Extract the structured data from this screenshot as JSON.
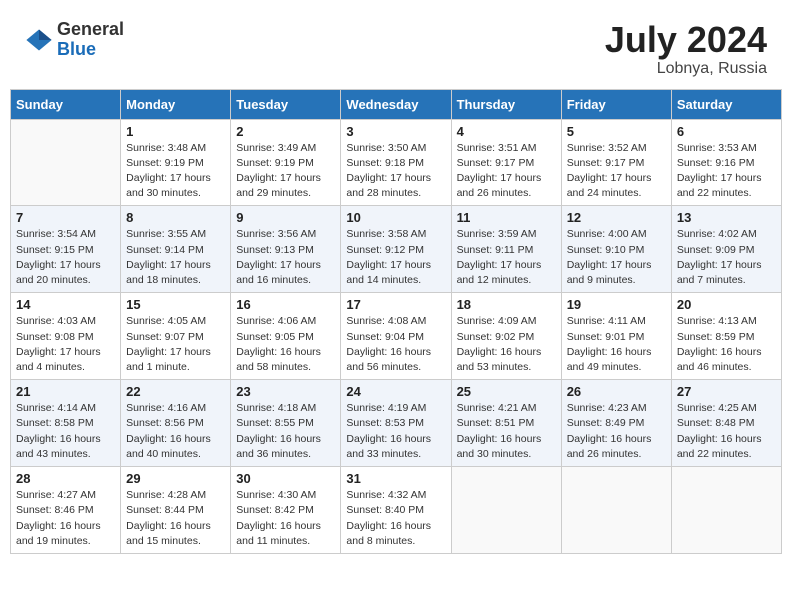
{
  "header": {
    "logo": {
      "line1": "General",
      "line2": "Blue"
    },
    "title": "July 2024",
    "location": "Lobnya, Russia"
  },
  "weekdays": [
    "Sunday",
    "Monday",
    "Tuesday",
    "Wednesday",
    "Thursday",
    "Friday",
    "Saturday"
  ],
  "weeks": [
    [
      {
        "day": "",
        "info": ""
      },
      {
        "day": "1",
        "info": "Sunrise: 3:48 AM\nSunset: 9:19 PM\nDaylight: 17 hours\nand 30 minutes."
      },
      {
        "day": "2",
        "info": "Sunrise: 3:49 AM\nSunset: 9:19 PM\nDaylight: 17 hours\nand 29 minutes."
      },
      {
        "day": "3",
        "info": "Sunrise: 3:50 AM\nSunset: 9:18 PM\nDaylight: 17 hours\nand 28 minutes."
      },
      {
        "day": "4",
        "info": "Sunrise: 3:51 AM\nSunset: 9:17 PM\nDaylight: 17 hours\nand 26 minutes."
      },
      {
        "day": "5",
        "info": "Sunrise: 3:52 AM\nSunset: 9:17 PM\nDaylight: 17 hours\nand 24 minutes."
      },
      {
        "day": "6",
        "info": "Sunrise: 3:53 AM\nSunset: 9:16 PM\nDaylight: 17 hours\nand 22 minutes."
      }
    ],
    [
      {
        "day": "7",
        "info": "Sunrise: 3:54 AM\nSunset: 9:15 PM\nDaylight: 17 hours\nand 20 minutes."
      },
      {
        "day": "8",
        "info": "Sunrise: 3:55 AM\nSunset: 9:14 PM\nDaylight: 17 hours\nand 18 minutes."
      },
      {
        "day": "9",
        "info": "Sunrise: 3:56 AM\nSunset: 9:13 PM\nDaylight: 17 hours\nand 16 minutes."
      },
      {
        "day": "10",
        "info": "Sunrise: 3:58 AM\nSunset: 9:12 PM\nDaylight: 17 hours\nand 14 minutes."
      },
      {
        "day": "11",
        "info": "Sunrise: 3:59 AM\nSunset: 9:11 PM\nDaylight: 17 hours\nand 12 minutes."
      },
      {
        "day": "12",
        "info": "Sunrise: 4:00 AM\nSunset: 9:10 PM\nDaylight: 17 hours\nand 9 minutes."
      },
      {
        "day": "13",
        "info": "Sunrise: 4:02 AM\nSunset: 9:09 PM\nDaylight: 17 hours\nand 7 minutes."
      }
    ],
    [
      {
        "day": "14",
        "info": "Sunrise: 4:03 AM\nSunset: 9:08 PM\nDaylight: 17 hours\nand 4 minutes."
      },
      {
        "day": "15",
        "info": "Sunrise: 4:05 AM\nSunset: 9:07 PM\nDaylight: 17 hours\nand 1 minute."
      },
      {
        "day": "16",
        "info": "Sunrise: 4:06 AM\nSunset: 9:05 PM\nDaylight: 16 hours\nand 58 minutes."
      },
      {
        "day": "17",
        "info": "Sunrise: 4:08 AM\nSunset: 9:04 PM\nDaylight: 16 hours\nand 56 minutes."
      },
      {
        "day": "18",
        "info": "Sunrise: 4:09 AM\nSunset: 9:02 PM\nDaylight: 16 hours\nand 53 minutes."
      },
      {
        "day": "19",
        "info": "Sunrise: 4:11 AM\nSunset: 9:01 PM\nDaylight: 16 hours\nand 49 minutes."
      },
      {
        "day": "20",
        "info": "Sunrise: 4:13 AM\nSunset: 8:59 PM\nDaylight: 16 hours\nand 46 minutes."
      }
    ],
    [
      {
        "day": "21",
        "info": "Sunrise: 4:14 AM\nSunset: 8:58 PM\nDaylight: 16 hours\nand 43 minutes."
      },
      {
        "day": "22",
        "info": "Sunrise: 4:16 AM\nSunset: 8:56 PM\nDaylight: 16 hours\nand 40 minutes."
      },
      {
        "day": "23",
        "info": "Sunrise: 4:18 AM\nSunset: 8:55 PM\nDaylight: 16 hours\nand 36 minutes."
      },
      {
        "day": "24",
        "info": "Sunrise: 4:19 AM\nSunset: 8:53 PM\nDaylight: 16 hours\nand 33 minutes."
      },
      {
        "day": "25",
        "info": "Sunrise: 4:21 AM\nSunset: 8:51 PM\nDaylight: 16 hours\nand 30 minutes."
      },
      {
        "day": "26",
        "info": "Sunrise: 4:23 AM\nSunset: 8:49 PM\nDaylight: 16 hours\nand 26 minutes."
      },
      {
        "day": "27",
        "info": "Sunrise: 4:25 AM\nSunset: 8:48 PM\nDaylight: 16 hours\nand 22 minutes."
      }
    ],
    [
      {
        "day": "28",
        "info": "Sunrise: 4:27 AM\nSunset: 8:46 PM\nDaylight: 16 hours\nand 19 minutes."
      },
      {
        "day": "29",
        "info": "Sunrise: 4:28 AM\nSunset: 8:44 PM\nDaylight: 16 hours\nand 15 minutes."
      },
      {
        "day": "30",
        "info": "Sunrise: 4:30 AM\nSunset: 8:42 PM\nDaylight: 16 hours\nand 11 minutes."
      },
      {
        "day": "31",
        "info": "Sunrise: 4:32 AM\nSunset: 8:40 PM\nDaylight: 16 hours\nand 8 minutes."
      },
      {
        "day": "",
        "info": ""
      },
      {
        "day": "",
        "info": ""
      },
      {
        "day": "",
        "info": ""
      }
    ]
  ]
}
